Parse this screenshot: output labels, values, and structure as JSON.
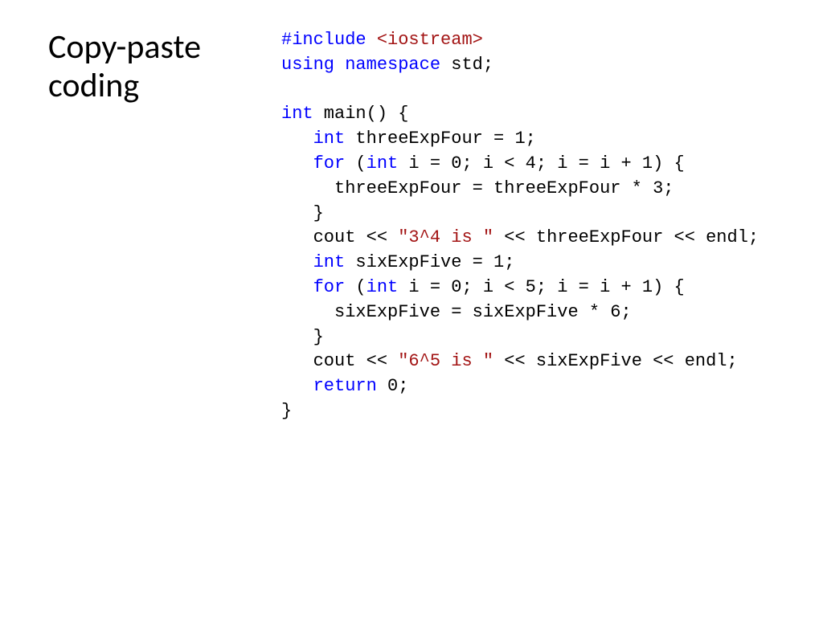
{
  "title_line1": "Copy-paste",
  "title_line2": "coding",
  "code": {
    "preproc_hash": "#include",
    "preproc_header": " <iostream>",
    "kw_using": "using",
    "kw_namespace": " namespace",
    "ns_std": " std;",
    "kw_int1": "int",
    "main_sig": " main() {",
    "kw_int2": "int",
    "var_tEF_decl": " threeExpFour = 1;",
    "kw_for1": "for",
    "for1_open": " (",
    "kw_int3": "int",
    "for1_rest": " i = 0; i < 4; i = i + 1) {",
    "tEF_body": "threeExpFour = threeExpFour * 3;",
    "brace_close1": "}",
    "cout1_a": "cout << ",
    "str1": "\"3^4 is \"",
    "cout1_b": " << threeExpFour << endl;",
    "kw_int4": "int",
    "var_sEF_decl": " sixExpFive = 1;",
    "kw_for2": "for",
    "for2_open": " (",
    "kw_int5": "int",
    "for2_rest": " i = 0; i < 5; i = i + 1) {",
    "sEF_body": "sixExpFive = sixExpFive * 6;",
    "brace_close2": "}",
    "cout2_a": "cout << ",
    "str2": "\"6^5 is \"",
    "cout2_b": " << sixExpFive << endl;",
    "kw_return": "return",
    "ret_val": " 0;",
    "brace_close3": "}"
  }
}
